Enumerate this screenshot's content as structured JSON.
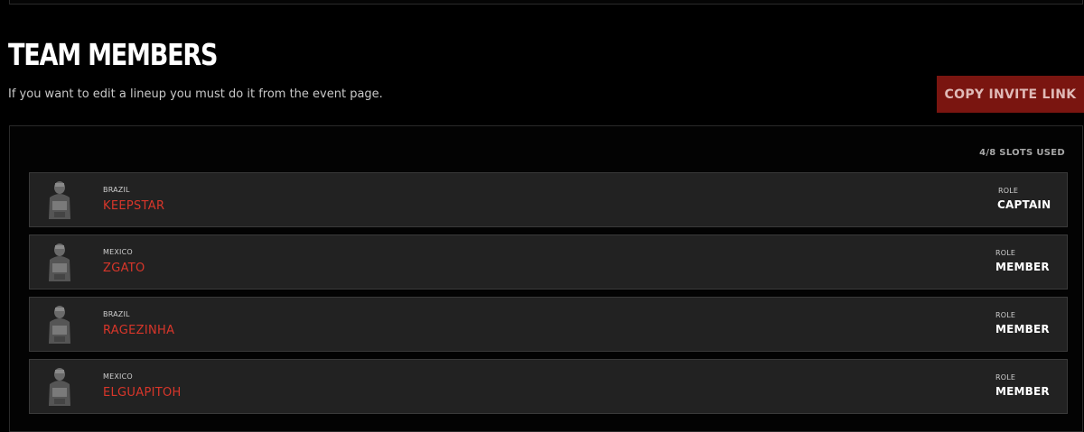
{
  "header": {
    "title": "TEAM MEMBERS",
    "subtitle": "If you want to edit a lineup you must do it from the event page.",
    "invite_button_label": "COPY INVITE LINK"
  },
  "panel": {
    "slots_used": "4/8 SLOTS USED",
    "role_label": "ROLE"
  },
  "members": [
    {
      "country": "BRAZIL",
      "name": "KEEPSTAR",
      "role": "CAPTAIN",
      "avatar_icon": "soldier-avatar-icon"
    },
    {
      "country": "MEXICO",
      "name": "ZGATO",
      "role": "MEMBER",
      "avatar_icon": "soldier-avatar-icon"
    },
    {
      "country": "BRAZIL",
      "name": "RAGEZINHA",
      "role": "MEMBER",
      "avatar_icon": "soldier-avatar-icon"
    },
    {
      "country": "MEXICO",
      "name": "ELGUAPITOH",
      "role": "MEMBER",
      "avatar_icon": "soldier-avatar-icon"
    }
  ],
  "colors": {
    "accent_red": "#d8362a",
    "button_bg": "#7a1510",
    "row_bg": "#222222"
  }
}
